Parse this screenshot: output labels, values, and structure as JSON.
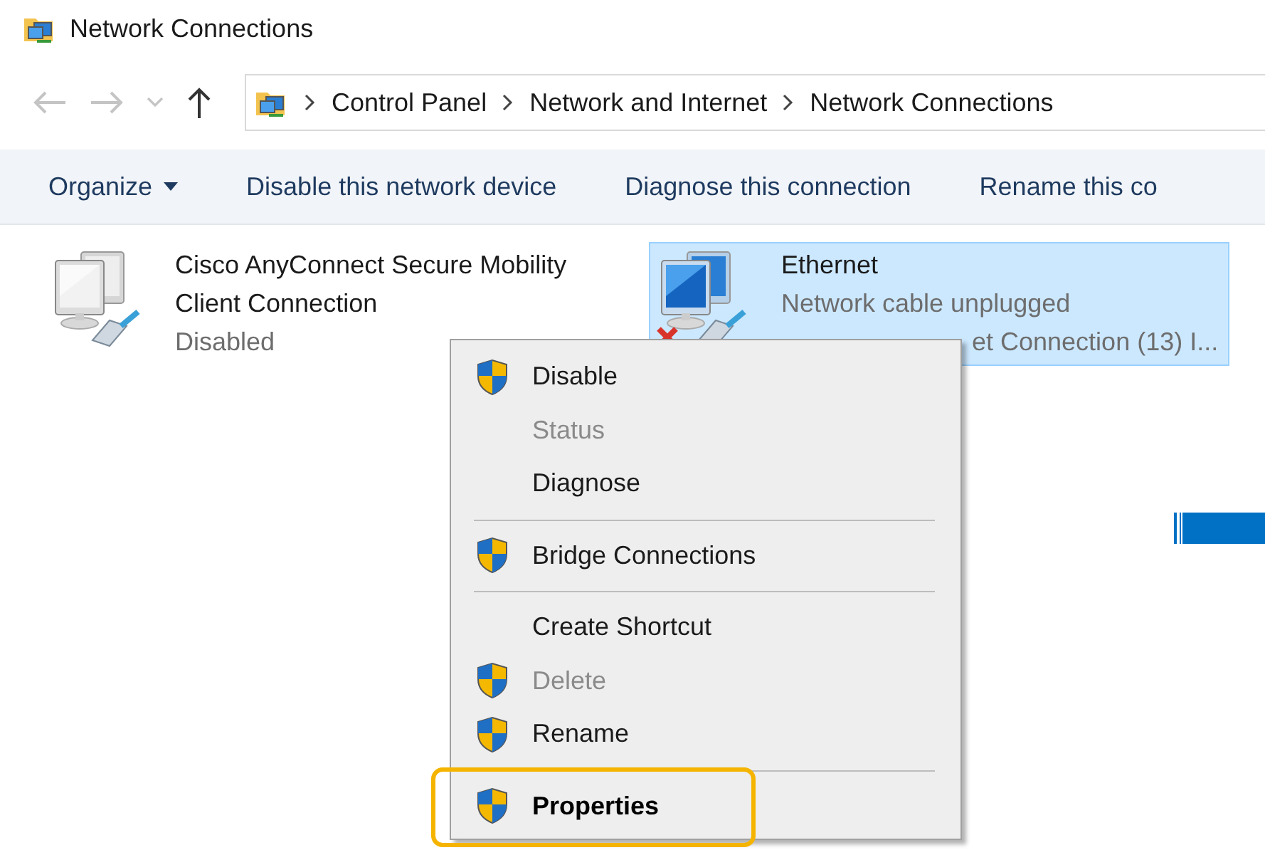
{
  "window": {
    "title": "Network Connections"
  },
  "nav": [
    {
      "kind": "back",
      "disabled": true
    },
    {
      "kind": "forward",
      "disabled": true
    },
    {
      "kind": "recent",
      "disabled": true
    },
    {
      "kind": "up",
      "disabled": false
    }
  ],
  "breadcrumb": [
    "Control Panel",
    "Network and Internet",
    "Network Connections"
  ],
  "toolbar": [
    {
      "label": "Organize",
      "dropdown": true
    },
    {
      "label": "Disable this network device",
      "dropdown": false
    },
    {
      "label": "Diagnose this connection",
      "dropdown": false
    },
    {
      "label": "Rename this co",
      "dropdown": false
    }
  ],
  "connections": [
    {
      "name": "Cisco AnyConnect Secure Mobility Client Connection",
      "lines": [
        "Disabled"
      ],
      "selected": false,
      "unplugged": false,
      "color_screen": false
    },
    {
      "name": "Ethernet",
      "lines": [
        "Network cable unplugged",
        "et Connection (13) I..."
      ],
      "selected": true,
      "unplugged": true,
      "color_screen": true
    }
  ],
  "context_menu": [
    {
      "kind": "item",
      "label": "Disable",
      "shield": true,
      "disabled": false,
      "default": false,
      "highlighted": false
    },
    {
      "kind": "item",
      "label": "Status",
      "shield": false,
      "disabled": true,
      "default": false,
      "highlighted": false
    },
    {
      "kind": "item",
      "label": "Diagnose",
      "shield": false,
      "disabled": false,
      "default": false,
      "highlighted": false
    },
    {
      "kind": "separator"
    },
    {
      "kind": "item",
      "label": "Bridge Connections",
      "shield": true,
      "disabled": false,
      "default": false,
      "highlighted": false
    },
    {
      "kind": "separator"
    },
    {
      "kind": "item",
      "label": "Create Shortcut",
      "shield": false,
      "disabled": false,
      "default": false,
      "highlighted": false
    },
    {
      "kind": "item",
      "label": "Delete",
      "shield": true,
      "disabled": true,
      "default": false,
      "highlighted": false
    },
    {
      "kind": "item",
      "label": "Rename",
      "shield": true,
      "disabled": false,
      "default": false,
      "highlighted": false
    },
    {
      "kind": "separator"
    },
    {
      "kind": "item",
      "label": "Properties",
      "shield": true,
      "disabled": false,
      "default": true,
      "highlighted": true
    }
  ]
}
